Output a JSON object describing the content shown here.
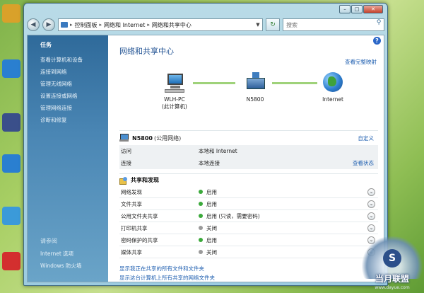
{
  "desktop": {
    "icons": [
      {
        "label": "",
        "color": "#d9a12a",
        "name": "leopard-icon"
      },
      {
        "label": "",
        "color": "#2a7fd0",
        "name": "ie-icon"
      },
      {
        "label": "",
        "color": "#3a4f8a",
        "name": "bird-icon"
      },
      {
        "label": "",
        "color": "#2a7fd0",
        "name": "ie-icon-2"
      },
      {
        "label": "",
        "color": "#3b9ad9",
        "name": "app-icon"
      },
      {
        "label": "",
        "color": "#d32f2f",
        "name": "m-icon"
      }
    ]
  },
  "window": {
    "caption_min": "–",
    "caption_max": "□",
    "caption_close": "✕"
  },
  "address": {
    "crumbs": [
      "控制面板",
      "网络和 Internet",
      "网络和共享中心"
    ],
    "search_placeholder": "搜索"
  },
  "sidebar": {
    "heading": "任务",
    "links": [
      "查看计算机和设备",
      "连接到网络",
      "管理无线网络",
      "设置连接或网络",
      "管理网络连接",
      "诊断和修复"
    ],
    "see_also_heading": "请参阅",
    "see_also": [
      "Internet 选项",
      "Windows 防火墙"
    ]
  },
  "main": {
    "title": "网络和共享中心",
    "full_map": "查看完整映射",
    "help": "?",
    "map_nodes": [
      {
        "name": "WLH-PC",
        "sub": "(此计算机)"
      },
      {
        "name": "N5800",
        "sub": ""
      },
      {
        "name": "Internet",
        "sub": ""
      }
    ],
    "network": {
      "name": "N5800",
      "type": "(公用网络)",
      "customize": "自定义",
      "rows": [
        {
          "key": "访问",
          "value": "本地和 Internet",
          "action": ""
        },
        {
          "key": "连接",
          "value": "本地连接",
          "action": "查看状态"
        }
      ]
    },
    "sharing": {
      "title": "共享和发现",
      "rows": [
        {
          "key": "网络发现",
          "value": "启用",
          "status": "on"
        },
        {
          "key": "文件共享",
          "value": "启用",
          "status": "on"
        },
        {
          "key": "公用文件夹共享",
          "value": "启用 (只读，需要密码)",
          "status": "on"
        },
        {
          "key": "打印机共享",
          "value": "关闭",
          "status": "off"
        },
        {
          "key": "密码保护的共享",
          "value": "启用",
          "status": "on"
        },
        {
          "key": "媒体共享",
          "value": "关闭",
          "status": "off"
        }
      ],
      "status_colors": {
        "on": "#3ba93b",
        "off": "#9a9a9a"
      }
    },
    "bottom_links": [
      "显示我正在共享的所有文件和文件夹",
      "显示这台计算机上所有共享的网络文件夹"
    ]
  },
  "watermark": {
    "letter": "S",
    "text": "当月联盟",
    "url": "www.dayue.com"
  }
}
